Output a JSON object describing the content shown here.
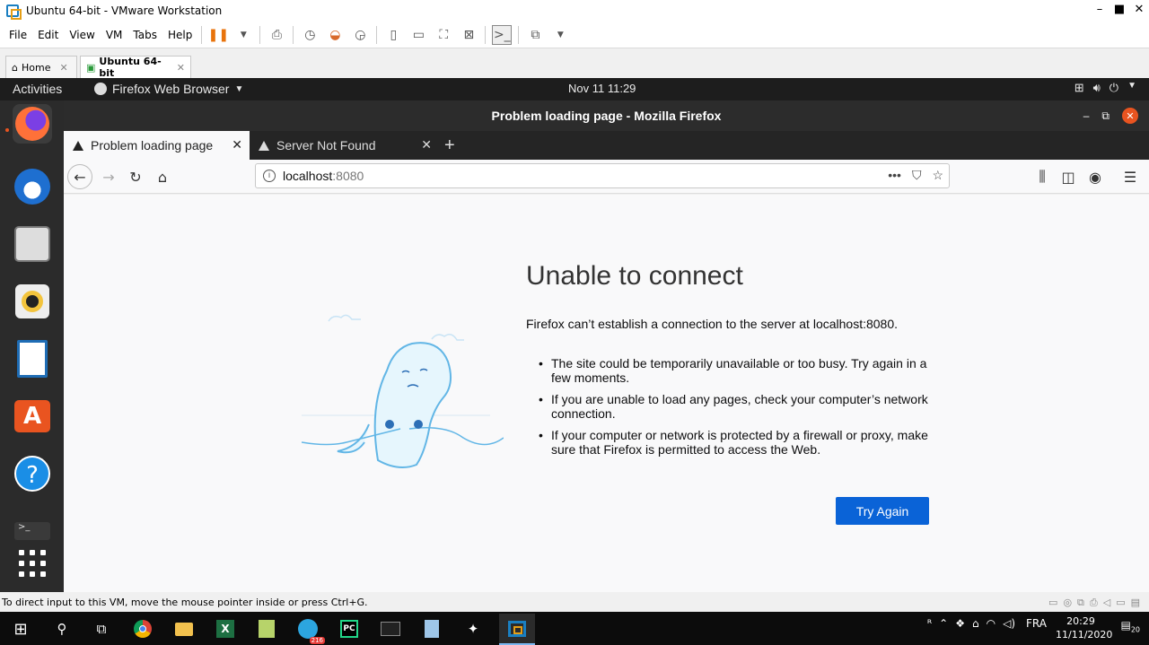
{
  "vmware": {
    "window_title": "Ubuntu 64-bit - VMware Workstation",
    "menu": [
      "File",
      "Edit",
      "View",
      "VM",
      "Tabs",
      "Help"
    ],
    "tabs": [
      {
        "label": "Home",
        "active": false
      },
      {
        "label": "Ubuntu 64-bit",
        "active": true
      }
    ],
    "status_text": "To direct input to this VM, move the mouse pointer inside or press Ctrl+G."
  },
  "gnome": {
    "activities": "Activities",
    "app_menu": "Firefox Web Browser",
    "clock": "Nov 11  11:29"
  },
  "dock": {
    "items": [
      "firefox-icon",
      "thunderbird-icon",
      "files-icon",
      "rhythmbox-icon",
      "writer-icon",
      "software-icon",
      "help-icon",
      "terminal-icon",
      "apps-grid-icon"
    ]
  },
  "firefox": {
    "window_title": "Problem loading page - Mozilla Firefox",
    "tabs": [
      {
        "label": "Problem loading page",
        "active": true
      },
      {
        "label": "Server Not Found",
        "active": false
      }
    ],
    "url_host": "localhost",
    "url_port": ":8080"
  },
  "error_page": {
    "title": "Unable to connect",
    "description": "Firefox can’t establish a connection to the server at localhost:8080.",
    "bullets": [
      "The site could be temporarily unavailable or too busy. Try again in a few moments.",
      "If you are unable to load any pages, check your computer’s network connection.",
      "If your computer or network is protected by a firewall or proxy, make sure that Firefox is permitted to access the Web."
    ],
    "button": "Try Again"
  },
  "windows": {
    "lang": "FRA",
    "time": "20:29",
    "date": "11/11/2020",
    "notifications": "20",
    "telegram_badge": "216"
  },
  "colors": {
    "ubuntu_orange": "#e95420",
    "firefox_blue": "#0a63d7",
    "dock_bg": "#2b2b2b"
  }
}
